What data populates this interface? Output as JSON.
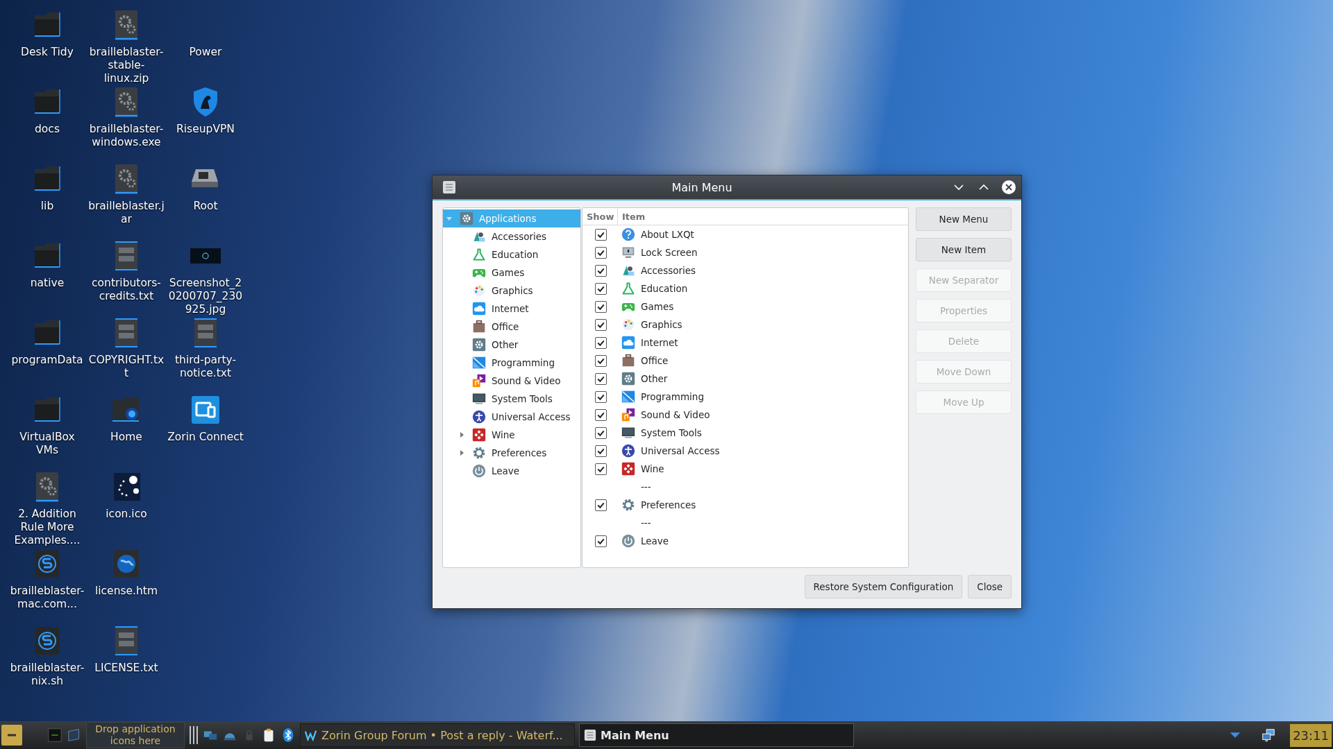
{
  "desktop_icons": [
    {
      "label": "Desk Tidy",
      "kind": "folder"
    },
    {
      "label": "docs",
      "kind": "folder"
    },
    {
      "label": "lib",
      "kind": "folder"
    },
    {
      "label": "native",
      "kind": "folder"
    },
    {
      "label": "programData",
      "kind": "folder"
    },
    {
      "label": "VirtualBox VMs",
      "kind": "folder"
    },
    {
      "label": "2. Addition Rule More Examples....",
      "kind": "gearfile"
    },
    {
      "label": "brailleblaster-mac.com...",
      "kind": "sapp"
    },
    {
      "label": "brailleblaster-nix.sh",
      "kind": "sapp"
    },
    {
      "label": "brailleblaster-stable-linux.zip",
      "kind": "gearfile"
    },
    {
      "label": "brailleblaster-windows.exe",
      "kind": "gearfile"
    },
    {
      "label": "brailleblaster.jar",
      "kind": "gearfile"
    },
    {
      "label": "contributors-credits.txt",
      "kind": "textfile"
    },
    {
      "label": "COPYRIGHT.txt",
      "kind": "textfile"
    },
    {
      "label": "Home",
      "kind": "home"
    },
    {
      "label": "icon.ico",
      "kind": "dots"
    },
    {
      "label": "license.htm",
      "kind": "globe"
    },
    {
      "label": "LICENSE.txt",
      "kind": "textfile"
    },
    {
      "label": "Power",
      "kind": "none"
    },
    {
      "label": "RiseupVPN",
      "kind": "shield"
    },
    {
      "label": "Root",
      "kind": "drive"
    },
    {
      "label": "Screenshot_20200707_230925.jpg",
      "kind": "image"
    },
    {
      "label": "third-party-notice.txt",
      "kind": "textfile"
    },
    {
      "label": "Zorin Connect",
      "kind": "connect"
    }
  ],
  "window": {
    "title": "Main Menu",
    "tree": [
      {
        "label": "Applications",
        "kind": "other",
        "selected": true,
        "expanded": true,
        "children": [
          {
            "label": "Accessories",
            "kind": "accessories",
            "selected": false
          },
          {
            "label": "Education",
            "kind": "education",
            "selected": false
          },
          {
            "label": "Games",
            "kind": "games",
            "selected": false
          },
          {
            "label": "Graphics",
            "kind": "graphics",
            "selected": false
          },
          {
            "label": "Internet",
            "kind": "internet",
            "selected": false
          },
          {
            "label": "Office",
            "kind": "office",
            "selected": false
          },
          {
            "label": "Other",
            "kind": "other",
            "selected": false
          },
          {
            "label": "Programming",
            "kind": "programming",
            "selected": false
          },
          {
            "label": "Sound & Video",
            "kind": "sound",
            "selected": false
          },
          {
            "label": "System Tools",
            "kind": "system",
            "selected": false
          },
          {
            "label": "Universal Access",
            "kind": "access",
            "selected": false
          },
          {
            "label": "Wine",
            "kind": "wine",
            "selected": false,
            "expanded": false
          },
          {
            "label": "Preferences",
            "kind": "prefs",
            "selected": false,
            "expanded": false
          },
          {
            "label": "Leave",
            "kind": "leave",
            "selected": false
          }
        ]
      }
    ],
    "table": {
      "columns": [
        "Show",
        "Item"
      ],
      "rows": [
        {
          "kind": "help",
          "checked": true,
          "label": "About LXQt"
        },
        {
          "kind": "lock",
          "checked": true,
          "label": "Lock Screen"
        },
        {
          "kind": "accessories",
          "checked": true,
          "label": "Accessories"
        },
        {
          "kind": "education",
          "checked": true,
          "label": "Education"
        },
        {
          "kind": "games",
          "checked": true,
          "label": "Games"
        },
        {
          "kind": "graphics",
          "checked": true,
          "label": "Graphics"
        },
        {
          "kind": "internet",
          "checked": true,
          "label": "Internet"
        },
        {
          "kind": "office",
          "checked": true,
          "label": "Office"
        },
        {
          "kind": "other",
          "checked": true,
          "label": "Other"
        },
        {
          "kind": "programming",
          "checked": true,
          "label": "Programming"
        },
        {
          "kind": "sound",
          "checked": true,
          "label": "Sound & Video"
        },
        {
          "kind": "system",
          "checked": true,
          "label": "System Tools"
        },
        {
          "kind": "access",
          "checked": true,
          "label": "Universal Access"
        },
        {
          "kind": "wine",
          "checked": true,
          "label": "Wine"
        },
        {
          "kind": "separator",
          "label": "---"
        },
        {
          "kind": "prefs",
          "checked": true,
          "label": "Preferences"
        },
        {
          "kind": "separator",
          "label": "---"
        },
        {
          "kind": "leave",
          "checked": true,
          "label": "Leave"
        }
      ]
    },
    "side_buttons": [
      {
        "label": "New Menu",
        "disabled": false
      },
      {
        "label": "New Item",
        "disabled": false
      },
      {
        "label": "New Separator",
        "disabled": true
      },
      {
        "label": "Properties",
        "disabled": true
      },
      {
        "label": "Delete",
        "disabled": true
      },
      {
        "label": "Move Down",
        "disabled": true
      },
      {
        "label": "Move Up",
        "disabled": true
      }
    ],
    "footer_buttons": [
      {
        "label": "Restore System Configuration",
        "disabled": false
      },
      {
        "label": "Close",
        "disabled": false
      }
    ]
  },
  "taskbar": {
    "drop_zone": "Drop application icons here",
    "tasks": [
      {
        "label": "Zorin Group Forum • Post a reply - Waterf...",
        "active": false
      },
      {
        "label": "Main Menu",
        "active": true
      }
    ],
    "clock": "23:11"
  }
}
